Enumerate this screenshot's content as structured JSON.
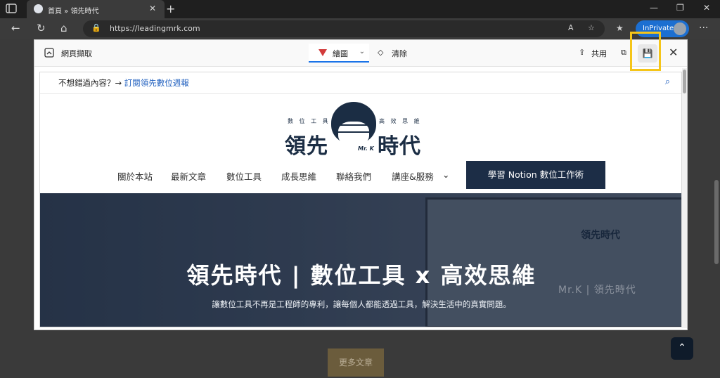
{
  "tab": {
    "title": "首頁 » 領先時代"
  },
  "addressbar": {
    "url": "https://leadingmrk.com",
    "inprivate_label": "InPrivate"
  },
  "capture_toolbar": {
    "web_capture": "網頁擷取",
    "draw": "繪圖",
    "erase": "清除",
    "share": "共用"
  },
  "site": {
    "announce_prefix": "不想錯過內容？→",
    "announce_link": "訂閱領先數位週報",
    "logo_left_small": "數 位 工 具",
    "logo_right_small": "高 效 思 維",
    "logo_big_left": "領先",
    "logo_big_right": "時代",
    "logo_mrk": "Mr. K",
    "menu": [
      "關於本站",
      "最新文章",
      "數位工具",
      "成長思維",
      "聯絡我們",
      "講座&服務"
    ],
    "cta": "學習 Notion 數位工作術",
    "hero_title": "領先時代 | 數位工具 x 高效思維",
    "hero_subtitle": "讓數位工具不再是工程師的專利，讓每個人都能透過工具，解決生活中的真實問題。",
    "hero_monitor_text": "Mr.K | 領先時代",
    "hero_monitor_logo": "領先時代"
  },
  "background_page": {
    "more_articles": "更多文章"
  },
  "colors": {
    "accent": "#1c6fd1",
    "highlight": "#f5c518",
    "brand_navy": "#1c2d46"
  }
}
